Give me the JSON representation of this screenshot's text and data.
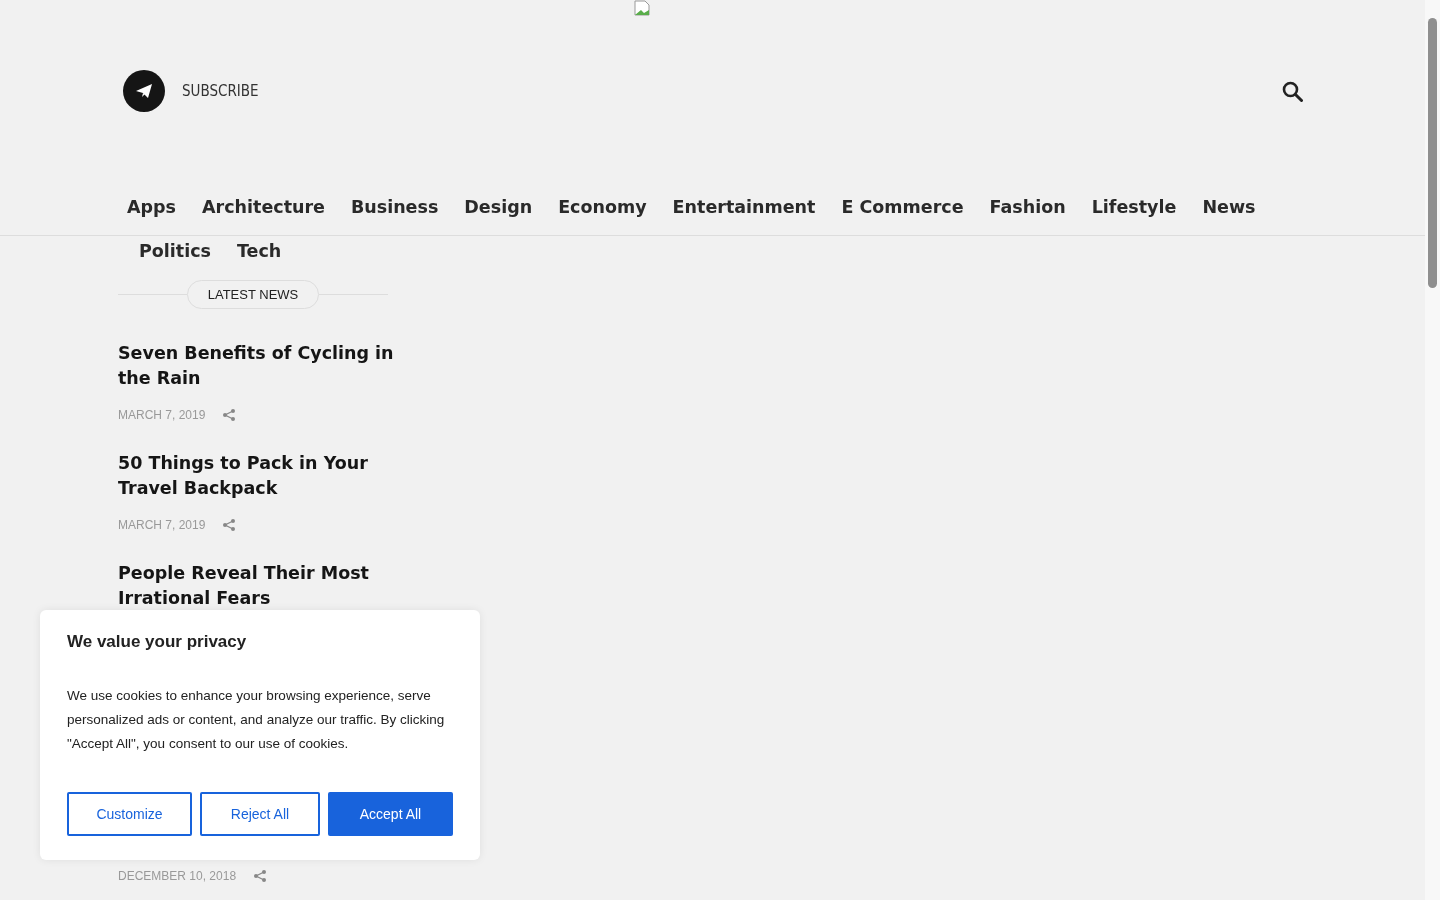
{
  "header": {
    "subscribe": "SUBSCRIBE"
  },
  "nav": [
    {
      "label": "Apps"
    },
    {
      "label": "Architecture"
    },
    {
      "label": "Business"
    },
    {
      "label": "Design"
    },
    {
      "label": "Economy"
    },
    {
      "label": "Entertainment"
    },
    {
      "label": "E Commerce"
    },
    {
      "label": "Fashion"
    },
    {
      "label": "Lifestyle"
    },
    {
      "label": "News"
    },
    {
      "label": "Politics"
    },
    {
      "label": "Tech"
    }
  ],
  "latest": {
    "heading": "LATEST NEWS",
    "articles": [
      {
        "title": "Seven Benefits of Cycling in the Rain",
        "date": "MARCH 7, 2019"
      },
      {
        "title": "50 Things to Pack in Your Travel Backpack",
        "date": "MARCH 7, 2019"
      },
      {
        "title": "People Reveal Their Most Irrational Fears"
      },
      {
        "date": "DECEMBER 10, 2018"
      }
    ]
  },
  "cookie_banner": {
    "title": "We value your privacy",
    "text": "We use cookies to enhance your browsing experience, serve personalized ads or content, and analyze our traffic. By clicking \"Accept All\", you consent to our use of cookies.",
    "buttons": [
      {
        "label": "Customize",
        "kind": "outline"
      },
      {
        "label": "Reject All",
        "kind": "outline"
      },
      {
        "label": "Accept All",
        "kind": "primary"
      }
    ]
  }
}
